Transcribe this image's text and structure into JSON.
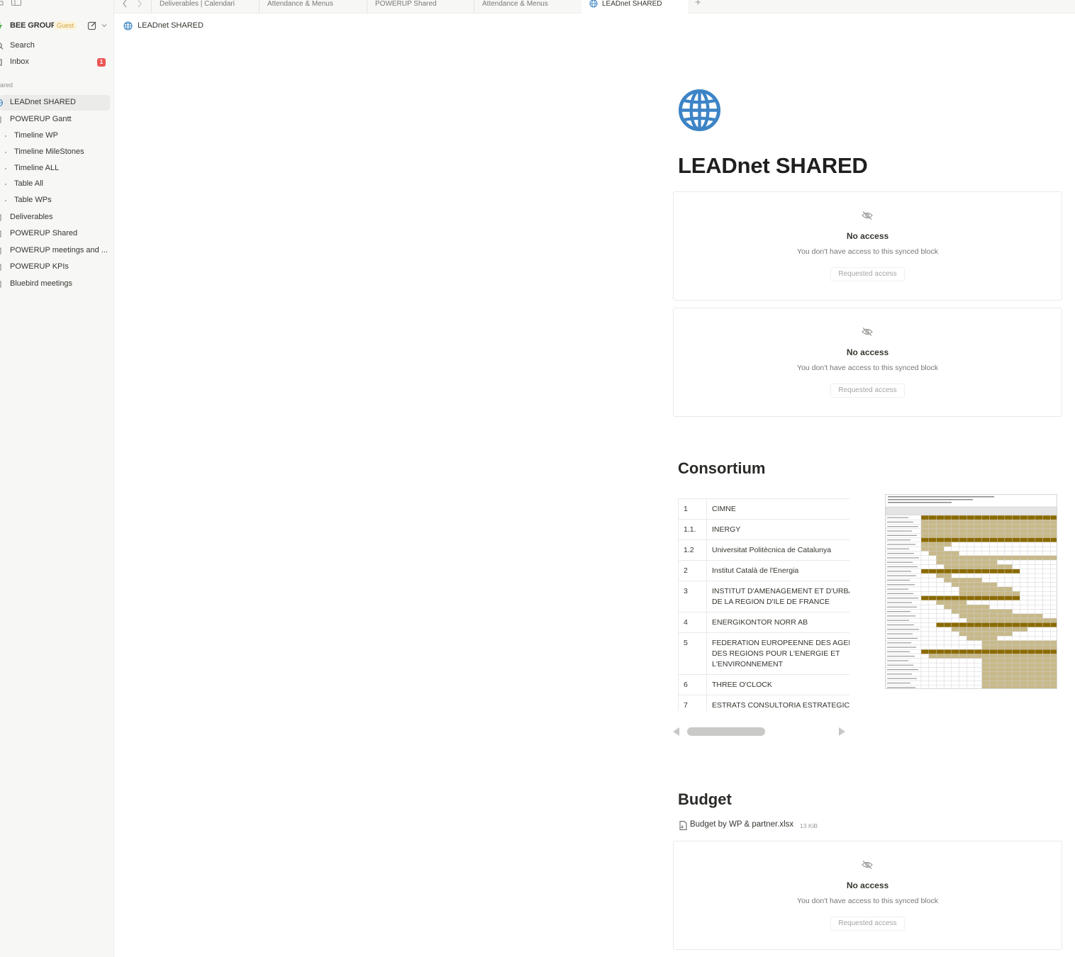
{
  "sidebar": {
    "workspace_name": "BEE GROUP",
    "workspace_badge": "Guest",
    "search_label": "Search",
    "inbox_label": "Inbox",
    "inbox_count": "1",
    "section_label": "ared",
    "items": [
      {
        "label": "LEADnet SHARED"
      },
      {
        "label": "POWERUP Gantt"
      },
      {
        "label": "Timeline WP"
      },
      {
        "label": "Timeline MileStones"
      },
      {
        "label": "Timeline ALL"
      },
      {
        "label": "Table All"
      },
      {
        "label": "Table WPs"
      },
      {
        "label": "Deliverables"
      },
      {
        "label": "POWERUP Shared"
      },
      {
        "label": "POWERUP meetings and ..."
      },
      {
        "label": "POWERUP KPIs"
      },
      {
        "label": "Bluebird meetings"
      }
    ]
  },
  "tabs": [
    {
      "label": "Deliverables | Calendari"
    },
    {
      "label": "Attendance & Menus"
    },
    {
      "label": "POWERUP Shared"
    },
    {
      "label": "Attendance & Menus"
    },
    {
      "label": "LEADnet SHARED"
    }
  ],
  "breadcrumb": {
    "label": "LEADnet SHARED"
  },
  "page": {
    "title": "LEADnet SHARED",
    "synced_blocks": [
      {
        "title": "No access",
        "desc": "You don't have access to this synced block",
        "button": "Requested access"
      },
      {
        "title": "No access",
        "desc": "You don't have access to this synced block",
        "button": "Requested access"
      },
      {
        "title": "No access",
        "desc": "You don't have access to this synced block",
        "button": "Requested access"
      }
    ],
    "consortium_heading": "Consortium",
    "consortium_rows": [
      {
        "num": "1",
        "name": "CIMNE"
      },
      {
        "num": "1.1.",
        "name": "INERGY"
      },
      {
        "num": "1.2",
        "name": "Universitat Politècnica de Catalunya"
      },
      {
        "num": "2",
        "name": "Institut Català de l'Energia"
      },
      {
        "num": "3",
        "name": "INSTITUT D'AMENAGEMENT ET D'URBANISME DE LA REGION D'ILE DE FRANCE"
      },
      {
        "num": "4",
        "name": "ENERGIKONTOR NORR AB"
      },
      {
        "num": "5",
        "name": "FEDERATION EUROPEENNE DES AGENCES ET DES REGIONS POUR L'ENERGIE ET L'ENVIRONNEMENT"
      },
      {
        "num": "6",
        "name": "THREE O'CLOCK"
      },
      {
        "num": "7",
        "name": "ESTRATS CONSULTORIA ESTRATEGICA SCCL"
      }
    ],
    "budget_heading": "Budget",
    "budget_file": {
      "name": "Budget by WP & partner.xlsx",
      "size": "13 KiB"
    }
  },
  "colors": {
    "accent_blue": "#3d84c6",
    "gantt_dark": "#8b6a00",
    "gantt_light": "#c8b98a",
    "inbox_badge": "#eb5757"
  }
}
